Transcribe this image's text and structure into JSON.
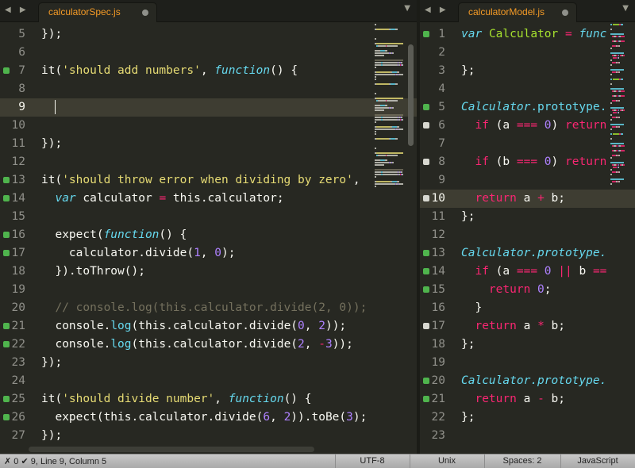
{
  "left_pane": {
    "nav_arrows": "◀ ▶",
    "tab_title": "calculatorSpec.js",
    "tab_dropdown": "▼",
    "lines": [
      {
        "n": "5",
        "marker": "",
        "tokens": [
          {
            "t": "});",
            "c": ""
          }
        ]
      },
      {
        "n": "6",
        "marker": "",
        "tokens": []
      },
      {
        "n": "7",
        "marker": "add",
        "tokens": [
          {
            "t": "it(",
            "c": ""
          },
          {
            "t": "'should add numbers'",
            "c": "st"
          },
          {
            "t": ", ",
            "c": ""
          },
          {
            "t": "function",
            "c": "fn"
          },
          {
            "t": "() {",
            "c": ""
          }
        ]
      },
      {
        "n": "8",
        "marker": "",
        "tokens": []
      },
      {
        "n": "9",
        "marker": "",
        "active": true,
        "caret": true,
        "tokens": []
      },
      {
        "n": "10",
        "marker": "",
        "tokens": []
      },
      {
        "n": "11",
        "marker": "",
        "tokens": [
          {
            "t": "});",
            "c": ""
          }
        ]
      },
      {
        "n": "12",
        "marker": "",
        "tokens": []
      },
      {
        "n": "13",
        "marker": "add",
        "tokens": [
          {
            "t": "it(",
            "c": ""
          },
          {
            "t": "'should throw error when dividing by zero'",
            "c": "st"
          },
          {
            "t": ",",
            "c": ""
          }
        ]
      },
      {
        "n": "14",
        "marker": "add",
        "tokens": [
          {
            "t": "  ",
            "c": ""
          },
          {
            "t": "var",
            "c": "fn"
          },
          {
            "t": " calculator ",
            "c": ""
          },
          {
            "t": "=",
            "c": "kw"
          },
          {
            "t": " this.calculator;",
            "c": ""
          }
        ]
      },
      {
        "n": "15",
        "marker": "",
        "tokens": []
      },
      {
        "n": "16",
        "marker": "add",
        "tokens": [
          {
            "t": "  expect(",
            "c": ""
          },
          {
            "t": "function",
            "c": "fn"
          },
          {
            "t": "() {",
            "c": ""
          }
        ]
      },
      {
        "n": "17",
        "marker": "add",
        "tokens": [
          {
            "t": "    calculator.divide(",
            "c": ""
          },
          {
            "t": "1",
            "c": "nu"
          },
          {
            "t": ", ",
            "c": ""
          },
          {
            "t": "0",
            "c": "nu"
          },
          {
            "t": ");",
            "c": ""
          }
        ]
      },
      {
        "n": "18",
        "marker": "",
        "tokens": [
          {
            "t": "  }).toThrow();",
            "c": ""
          }
        ]
      },
      {
        "n": "19",
        "marker": "",
        "tokens": []
      },
      {
        "n": "20",
        "marker": "",
        "tokens": [
          {
            "t": "  // console.log(this.calculator.divide(2, 0));",
            "c": "cm"
          }
        ]
      },
      {
        "n": "21",
        "marker": "add",
        "tokens": [
          {
            "t": "  console.",
            "c": ""
          },
          {
            "t": "log",
            "c": "cl"
          },
          {
            "t": "(this.calculator.divide(",
            "c": ""
          },
          {
            "t": "0",
            "c": "nu"
          },
          {
            "t": ", ",
            "c": ""
          },
          {
            "t": "2",
            "c": "nu"
          },
          {
            "t": "));",
            "c": ""
          }
        ]
      },
      {
        "n": "22",
        "marker": "add",
        "tokens": [
          {
            "t": "  console.",
            "c": ""
          },
          {
            "t": "log",
            "c": "cl"
          },
          {
            "t": "(this.calculator.divide(",
            "c": ""
          },
          {
            "t": "2",
            "c": "nu"
          },
          {
            "t": ", ",
            "c": ""
          },
          {
            "t": "-",
            "c": "kw"
          },
          {
            "t": "3",
            "c": "nu"
          },
          {
            "t": "));",
            "c": ""
          }
        ]
      },
      {
        "n": "23",
        "marker": "",
        "tokens": [
          {
            "t": "});",
            "c": ""
          }
        ]
      },
      {
        "n": "24",
        "marker": "",
        "tokens": []
      },
      {
        "n": "25",
        "marker": "add",
        "tokens": [
          {
            "t": "it(",
            "c": ""
          },
          {
            "t": "'should divide number'",
            "c": "st"
          },
          {
            "t": ", ",
            "c": ""
          },
          {
            "t": "function",
            "c": "fn"
          },
          {
            "t": "() {",
            "c": ""
          }
        ]
      },
      {
        "n": "26",
        "marker": "add",
        "tokens": [
          {
            "t": "  expect(this.calculator.divide(",
            "c": ""
          },
          {
            "t": "6",
            "c": "nu"
          },
          {
            "t": ", ",
            "c": ""
          },
          {
            "t": "2",
            "c": "nu"
          },
          {
            "t": ")).toBe(",
            "c": ""
          },
          {
            "t": "3",
            "c": "nu"
          },
          {
            "t": ");",
            "c": ""
          }
        ]
      },
      {
        "n": "27",
        "marker": "",
        "tokens": [
          {
            "t": "});",
            "c": ""
          }
        ]
      }
    ]
  },
  "right_pane": {
    "nav_arrows": "◀ ▶",
    "tab_title": "calculatorModel.js",
    "tab_dropdown": "▼",
    "lines": [
      {
        "n": "1",
        "marker": "add",
        "tokens": [
          {
            "t": "var",
            "c": "fn"
          },
          {
            "t": " ",
            "c": ""
          },
          {
            "t": "Calculator",
            "c": "wv"
          },
          {
            "t": " = ",
            "c": "kw"
          },
          {
            "t": "func",
            "c": "fn"
          }
        ]
      },
      {
        "n": "2",
        "marker": "",
        "tokens": []
      },
      {
        "n": "3",
        "marker": "",
        "tokens": [
          {
            "t": "};",
            "c": ""
          }
        ]
      },
      {
        "n": "4",
        "marker": "",
        "tokens": []
      },
      {
        "n": "5",
        "marker": "add",
        "tokens": [
          {
            "t": "Calculator",
            "c": "fn"
          },
          {
            "t": ".prototype.",
            "c": "cl"
          }
        ]
      },
      {
        "n": "6",
        "marker": "mod",
        "tokens": [
          {
            "t": "  ",
            "c": ""
          },
          {
            "t": "if",
            "c": "kw"
          },
          {
            "t": " (a ",
            "c": ""
          },
          {
            "t": "===",
            "c": "kw"
          },
          {
            "t": " ",
            "c": ""
          },
          {
            "t": "0",
            "c": "nu"
          },
          {
            "t": ") ",
            "c": ""
          },
          {
            "t": "return",
            "c": "kw"
          }
        ]
      },
      {
        "n": "7",
        "marker": "",
        "tokens": []
      },
      {
        "n": "8",
        "marker": "mod",
        "tokens": [
          {
            "t": "  ",
            "c": ""
          },
          {
            "t": "if",
            "c": "kw"
          },
          {
            "t": " (b ",
            "c": ""
          },
          {
            "t": "===",
            "c": "kw"
          },
          {
            "t": " ",
            "c": ""
          },
          {
            "t": "0",
            "c": "nu"
          },
          {
            "t": ") ",
            "c": ""
          },
          {
            "t": "return",
            "c": "kw"
          }
        ]
      },
      {
        "n": "9",
        "marker": "",
        "tokens": []
      },
      {
        "n": "10",
        "marker": "mod",
        "active": true,
        "tokens": [
          {
            "t": "  ",
            "c": ""
          },
          {
            "t": "return",
            "c": "kw"
          },
          {
            "t": " a ",
            "c": ""
          },
          {
            "t": "+",
            "c": "kw"
          },
          {
            "t": " b;",
            "c": ""
          }
        ]
      },
      {
        "n": "11",
        "marker": "",
        "tokens": [
          {
            "t": "};",
            "c": ""
          }
        ]
      },
      {
        "n": "12",
        "marker": "",
        "tokens": []
      },
      {
        "n": "13",
        "marker": "add",
        "tokens": [
          {
            "t": "Calculator",
            "c": "fn"
          },
          {
            "t": ".prototype.",
            "c": "fn"
          }
        ]
      },
      {
        "n": "14",
        "marker": "add",
        "tokens": [
          {
            "t": "  ",
            "c": ""
          },
          {
            "t": "if",
            "c": "kw"
          },
          {
            "t": " (a ",
            "c": ""
          },
          {
            "t": "===",
            "c": "kw"
          },
          {
            "t": " ",
            "c": ""
          },
          {
            "t": "0",
            "c": "nu"
          },
          {
            "t": " ",
            "c": ""
          },
          {
            "t": "||",
            "c": "kw"
          },
          {
            "t": " b ",
            "c": ""
          },
          {
            "t": "==",
            "c": "kw"
          }
        ]
      },
      {
        "n": "15",
        "marker": "add",
        "tokens": [
          {
            "t": "    ",
            "c": ""
          },
          {
            "t": "return",
            "c": "kw"
          },
          {
            "t": " ",
            "c": ""
          },
          {
            "t": "0",
            "c": "nu"
          },
          {
            "t": ";",
            "c": ""
          }
        ]
      },
      {
        "n": "16",
        "marker": "",
        "tokens": [
          {
            "t": "  }",
            "c": ""
          }
        ]
      },
      {
        "n": "17",
        "marker": "mod",
        "tokens": [
          {
            "t": "  ",
            "c": ""
          },
          {
            "t": "return",
            "c": "kw"
          },
          {
            "t": " a ",
            "c": ""
          },
          {
            "t": "*",
            "c": "kw"
          },
          {
            "t": " b;",
            "c": ""
          }
        ]
      },
      {
        "n": "18",
        "marker": "",
        "tokens": [
          {
            "t": "};",
            "c": ""
          }
        ]
      },
      {
        "n": "19",
        "marker": "",
        "tokens": []
      },
      {
        "n": "20",
        "marker": "add",
        "tokens": [
          {
            "t": "Calculator",
            "c": "fn"
          },
          {
            "t": ".prototype.",
            "c": "fn"
          }
        ]
      },
      {
        "n": "21",
        "marker": "add",
        "tokens": [
          {
            "t": "  ",
            "c": ""
          },
          {
            "t": "return",
            "c": "kw"
          },
          {
            "t": " a ",
            "c": ""
          },
          {
            "t": "-",
            "c": "kw"
          },
          {
            "t": " b;",
            "c": ""
          }
        ]
      },
      {
        "n": "22",
        "marker": "",
        "tokens": [
          {
            "t": "};",
            "c": ""
          }
        ]
      },
      {
        "n": "23",
        "marker": "",
        "tokens": []
      }
    ]
  },
  "status_bar": {
    "left": "✗ 0 ✔ 9, Line 9, Column 5",
    "encoding": "UTF-8",
    "line_endings": "Unix",
    "indentation": "Spaces: 2",
    "syntax": "JavaScript"
  },
  "colors": {
    "background": "#272822",
    "string": "#e6db74",
    "keyword": "#f92672",
    "number": "#ae81ff",
    "storage": "#66d9ef",
    "comment": "#75715e",
    "git_added": "#4fb44d",
    "git_modified": "#d8d8d0",
    "tab_title": "#f39a26"
  }
}
